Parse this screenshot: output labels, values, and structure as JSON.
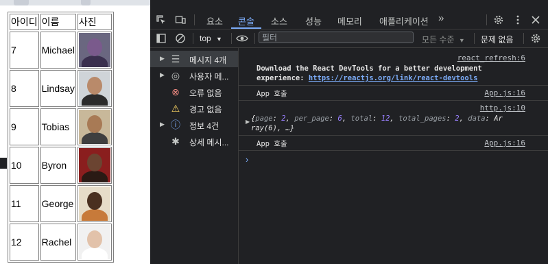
{
  "table": {
    "headers": [
      "아이디",
      "이름",
      "사진"
    ],
    "rows": [
      {
        "id": "7",
        "name": "Michael",
        "avatar": {
          "bg": "#6a6780",
          "skin": "#7a5a8c",
          "shirt": "#3a2f4e"
        }
      },
      {
        "id": "8",
        "name": "Lindsay",
        "avatar": {
          "bg": "#cfd4d8",
          "skin": "#b98a6a",
          "shirt": "#2b2b2b"
        }
      },
      {
        "id": "9",
        "name": "Tobias",
        "avatar": {
          "bg": "#c8b89a",
          "skin": "#a87a55",
          "shirt": "#3f3f3f"
        }
      },
      {
        "id": "10",
        "name": "Byron",
        "avatar": {
          "bg": "#8a1e1e",
          "skin": "#6b4431",
          "shirt": "#2a1a14"
        }
      },
      {
        "id": "11",
        "name": "George",
        "avatar": {
          "bg": "#e6dcc8",
          "skin": "#4a3020",
          "shirt": "#c77a3a"
        }
      },
      {
        "id": "12",
        "name": "Rachel",
        "avatar": {
          "bg": "#f1f1f1",
          "skin": "#e2c2aa",
          "shirt": "#ffffff"
        }
      }
    ]
  },
  "devtools": {
    "tabs": [
      {
        "label": "요소",
        "active": false
      },
      {
        "label": "콘솔",
        "active": true
      },
      {
        "label": "소스",
        "active": false
      },
      {
        "label": "성능",
        "active": false
      },
      {
        "label": "메모리",
        "active": false
      },
      {
        "label": "애플리케이션",
        "active": false
      }
    ],
    "more_tabs": "»",
    "toolbar": {
      "context": "top",
      "filter_placeholder": "필터",
      "levels": "모든 수준",
      "issues": "문제 없음"
    },
    "sidebar": [
      {
        "label": "메시지 4개",
        "icon": "list-icon",
        "glyph": "☰",
        "color": "#c4c7c5",
        "expandable": true,
        "selected": true
      },
      {
        "label": "사용자 메...",
        "icon": "user-icon",
        "glyph": "◎",
        "color": "#c4c7c5",
        "expandable": true,
        "selected": false
      },
      {
        "label": "오류 없음",
        "icon": "error-icon",
        "glyph": "⊗",
        "color": "#f28b82",
        "expandable": false,
        "selected": false
      },
      {
        "label": "경고 없음",
        "icon": "warning-icon",
        "glyph": "⚠",
        "color": "#fdd663",
        "expandable": false,
        "selected": false
      },
      {
        "label": "정보 4건",
        "icon": "info-icon",
        "glyph": "ⓘ",
        "color": "#7cacf8",
        "expandable": true,
        "selected": false
      },
      {
        "label": "상세 메시...",
        "icon": "bug-icon",
        "glyph": "✱",
        "color": "#c4c7c5",
        "expandable": false,
        "selected": false
      }
    ],
    "console": {
      "msg1_source": "react_refresh:6",
      "msg1_text_line1": "Download the React DevTools for a better development",
      "msg1_text_line2": "experience: ",
      "msg1_link": "https://reactjs.org/link/react-devtools",
      "msg2_text": "App 호출",
      "msg2_source": "App.js:16",
      "msg3_source": "http.js:10",
      "msg3_obj": {
        "open": "{",
        "k_page": "page",
        "v_page": "2",
        "k_per_page": "per_page",
        "v_per_page": "6",
        "k_total": "total",
        "v_total": "12",
        "k_total_pages": "total_pages",
        "v_total_pages": "2",
        "k_data": "data",
        "v_data_1": "Ar",
        "v_data_2": "ray(6)",
        "tail": ", …}"
      },
      "msg4_text": "App 호출",
      "msg4_source": "App.js:16",
      "prompt": "›"
    }
  }
}
